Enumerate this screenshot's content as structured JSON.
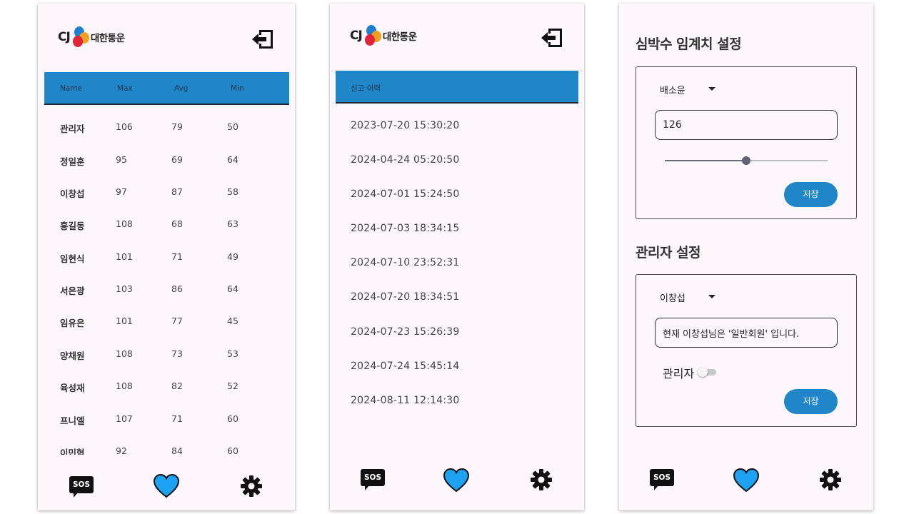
{
  "brand": {
    "cj": "CJ",
    "name": "대한통운"
  },
  "colors": {
    "accent": "#1f86c8",
    "heart": "#1da1f2",
    "logo_blue": "#1f7fd1",
    "logo_orange": "#f2a01e",
    "logo_red": "#e0243a"
  },
  "icons": {
    "logout": "logout-icon",
    "sos": "sos-icon",
    "heart": "heart-icon",
    "settings": "gear-icon"
  },
  "nav": {
    "sos_label": "SOS"
  },
  "screen1": {
    "columns": [
      "Name",
      "Max",
      "Avg",
      "Min"
    ],
    "rows": [
      {
        "name": "관리자",
        "max": "106",
        "avg": "79",
        "min": "50"
      },
      {
        "name": "정일훈",
        "max": "95",
        "avg": "69",
        "min": "64"
      },
      {
        "name": "이창섭",
        "max": "97",
        "avg": "87",
        "min": "58"
      },
      {
        "name": "홍길동",
        "max": "108",
        "avg": "68",
        "min": "63"
      },
      {
        "name": "임현식",
        "max": "101",
        "avg": "71",
        "min": "49"
      },
      {
        "name": "서은광",
        "max": "103",
        "avg": "86",
        "min": "64"
      },
      {
        "name": "임유은",
        "max": "101",
        "avg": "77",
        "min": "45"
      },
      {
        "name": "양채원",
        "max": "108",
        "avg": "73",
        "min": "53"
      },
      {
        "name": "육성재",
        "max": "108",
        "avg": "82",
        "min": "52"
      },
      {
        "name": "프니엘",
        "max": "107",
        "avg": "71",
        "min": "60"
      },
      {
        "name": "이민혁",
        "max": "92",
        "avg": "84",
        "min": "60"
      }
    ]
  },
  "screen2": {
    "header": "신고 이력",
    "history": [
      "2023-07-20 15:30:20",
      "2024-04-24 05:20:50",
      "2024-07-01 15:24:50",
      "2024-07-03 18:34:15",
      "2024-07-10 23:52:31",
      "2024-07-20 18:34:51",
      "2024-07-23 15:26:39",
      "2024-07-24 15:45:14",
      "2024-08-11 12:14:30"
    ]
  },
  "screen3": {
    "threshold": {
      "title": "심박수 임계치 설정",
      "selected": "배소윤",
      "value": "126",
      "slider_fraction": 0.5,
      "save_label": "저장"
    },
    "admin": {
      "title": "관리자 설정",
      "selected": "이창섭",
      "status_text": "현재 이창섭님은 '일반회원' 입니다.",
      "toggle_label": "관리자",
      "toggle_on": false,
      "save_label": "저장"
    }
  }
}
